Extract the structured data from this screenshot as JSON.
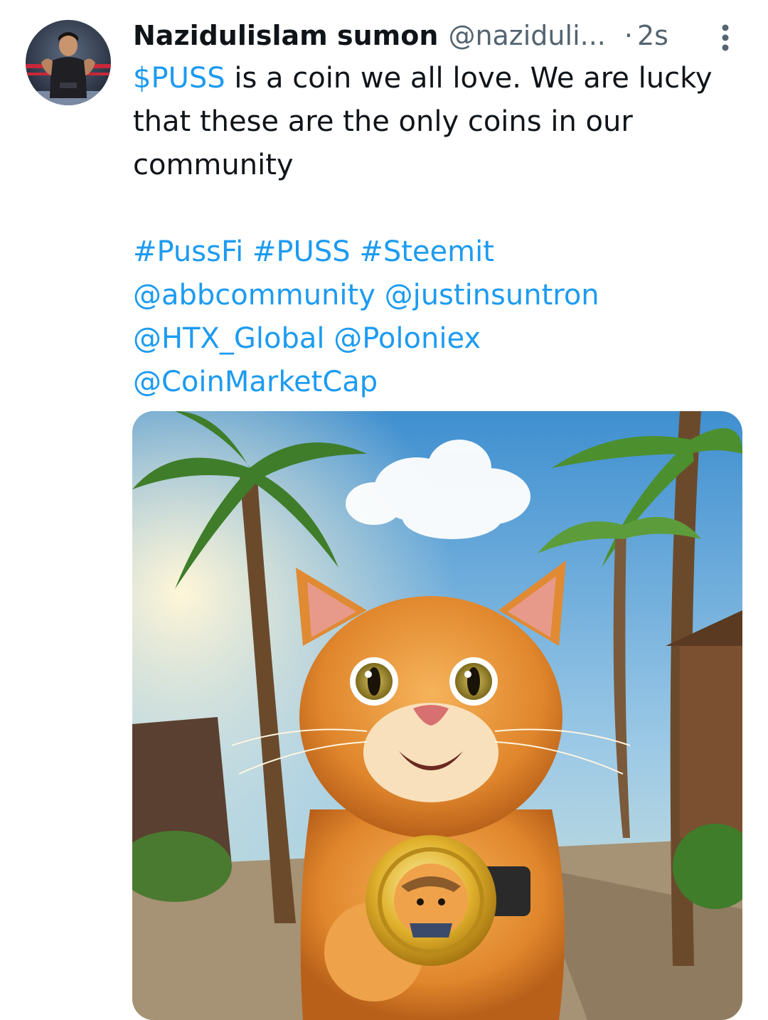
{
  "author": {
    "name": "Nazidulislam sumon",
    "handle": "@naziduli...",
    "separator": "·",
    "time": "2s"
  },
  "tweet": {
    "line1_link": "$PUSS",
    "line1_rest": " is a coin we all love. We are lucky",
    "line2": "that these are the only coins in our",
    "line3": "community",
    "hashtags": [
      "#PussFi",
      "#PUSS",
      "#Steemit"
    ],
    "mentions": [
      "@abbcommunity",
      "@justinsuntron",
      "@HTX_Global",
      "@Poloniex",
      "@CoinMarketCap"
    ]
  },
  "icons": {
    "more": "more-vertical-icon",
    "avatar": "avatar"
  },
  "colors": {
    "link": "#1d9bf0",
    "text": "#0f1419",
    "secondary": "#536471"
  }
}
